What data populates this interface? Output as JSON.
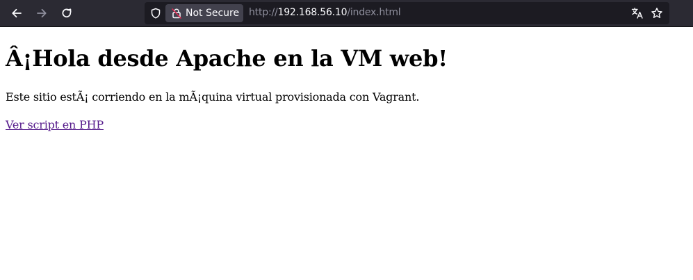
{
  "browser": {
    "security_label": "Not Secure",
    "url_prefix": "http://",
    "url_host": "192.168.56.10",
    "url_path": "/index.html",
    "icons": {
      "back": "back-arrow-icon",
      "forward": "forward-arrow-icon",
      "reload": "reload-icon",
      "shield": "tracking-shield-icon",
      "lock": "insecure-lock-icon",
      "translate": "translate-icon",
      "bookmark": "bookmark-star-icon"
    },
    "colors": {
      "toolbar": "#2b2a33",
      "urlbar": "#1c1b22",
      "pill": "#42414d",
      "insecure_lock": "#e22850"
    }
  },
  "page": {
    "heading": "Â¡Hola desde Apache en la VM web!",
    "description": "Este sitio estÃ¡ corriendo en la mÃ¡quina virtual provisionada con Vagrant.",
    "link_text": "Ver script en PHP",
    "colors": {
      "visited_link": "#551a8b"
    }
  }
}
